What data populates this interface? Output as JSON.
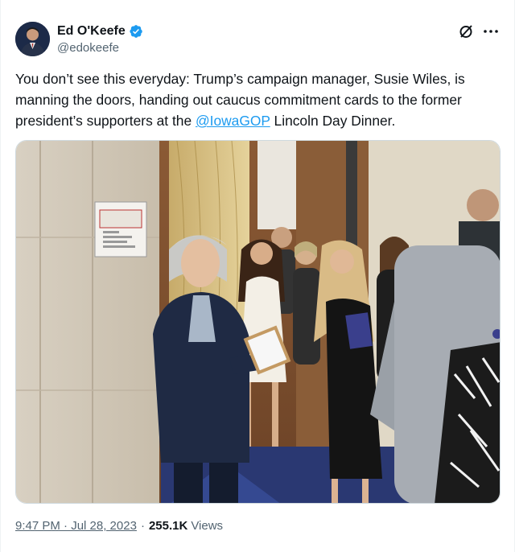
{
  "author": {
    "display_name": "Ed O'Keefe",
    "handle": "@edokeefe",
    "verified": true,
    "avatar_icon": "profile-photo",
    "verified_icon": "verified-badge-icon",
    "accent": "#1d9bf0"
  },
  "tweet": {
    "text_before": "You don’t see this everyday: Trump’s campaign manager, Susie Wiles, is manning the doors, handing out caucus commitment cards to the former president’s supporters at the ",
    "mention": "@IowaGOP",
    "text_after": " Lincoln Day Dinner."
  },
  "photo": {
    "sign_text": "EVACUATION PLAN"
  },
  "meta": {
    "time": "9:47 PM · Jul 28, 2023",
    "separator": "·",
    "views_count": "255.1K",
    "views_label": "Views"
  },
  "actions": {
    "grok_icon": "grok-icon",
    "more_icon": "more-options-icon"
  }
}
